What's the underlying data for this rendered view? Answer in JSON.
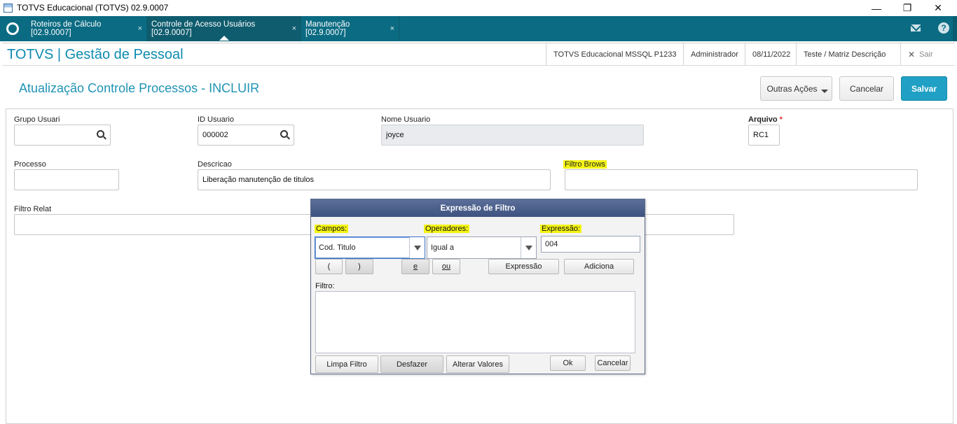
{
  "window": {
    "title": "TOTVS Educacional (TOTVS) 02.9.0007",
    "minimize": "—",
    "restore": "❐",
    "close": "✕"
  },
  "tabs": [
    {
      "label": "Roteiros de Cálculo [02.9.0007]",
      "close": "×"
    },
    {
      "label": "Controle de Acesso Usuários [02.9.0007]",
      "close": "×"
    },
    {
      "label": "Manutenção [02.9.0007]",
      "close": "×"
    }
  ],
  "header": {
    "brand": "TOTVS | Gestão de Pessoal",
    "environment": "TOTVS Educacional MSSQL P1233",
    "user": "Administrador",
    "date": "08/11/2022",
    "branch": "Teste / Matriz Descrição",
    "exit": "Sair",
    "exit_icon": "✕"
  },
  "page": {
    "title": "Atualização Controle Processos - INCLUIR",
    "other_actions": "Outras Ações",
    "cancel": "Cancelar",
    "save": "Salvar"
  },
  "form": {
    "grupo_usuari_label": "Grupo Usuari",
    "grupo_usuari_value": "",
    "id_usuario_label": "ID Usuario",
    "id_usuario_value": "000002",
    "nome_usuario_label": "Nome Usuario",
    "nome_usuario_value": "joyce",
    "arquivo_label": "Arquivo",
    "arquivo_required": "*",
    "arquivo_value": "RC1",
    "processo_label": "Processo",
    "processo_value": "",
    "descricao_label": "Descricao",
    "descricao_value": "Liberação manutenção de titulos",
    "filtro_brows_label": "Filtro Brows",
    "filtro_brows_value": "",
    "filtro_relat_label": "Filtro Relat",
    "filtro_relat_value": ""
  },
  "dialog": {
    "title": "Expressão de Filtro",
    "campos_label": "Campos:",
    "campos_value": "Cod. Titulo",
    "operadores_label": "Operadores:",
    "operadores_value": "Igual a",
    "expressao_label": "Expressão:",
    "expressao_value": "004",
    "open_paren": "(",
    "close_paren": ")",
    "and": "e",
    "or": "ou",
    "expression_btn": "Expressão",
    "add_btn": "Adiciona",
    "filtro_label": "Filtro:",
    "filtro_value": "",
    "clear_filter": "Limpa Filtro",
    "undo": "Desfazer",
    "change_values": "Alterar Valores",
    "ok": "Ok",
    "cancel": "Cancelar"
  }
}
